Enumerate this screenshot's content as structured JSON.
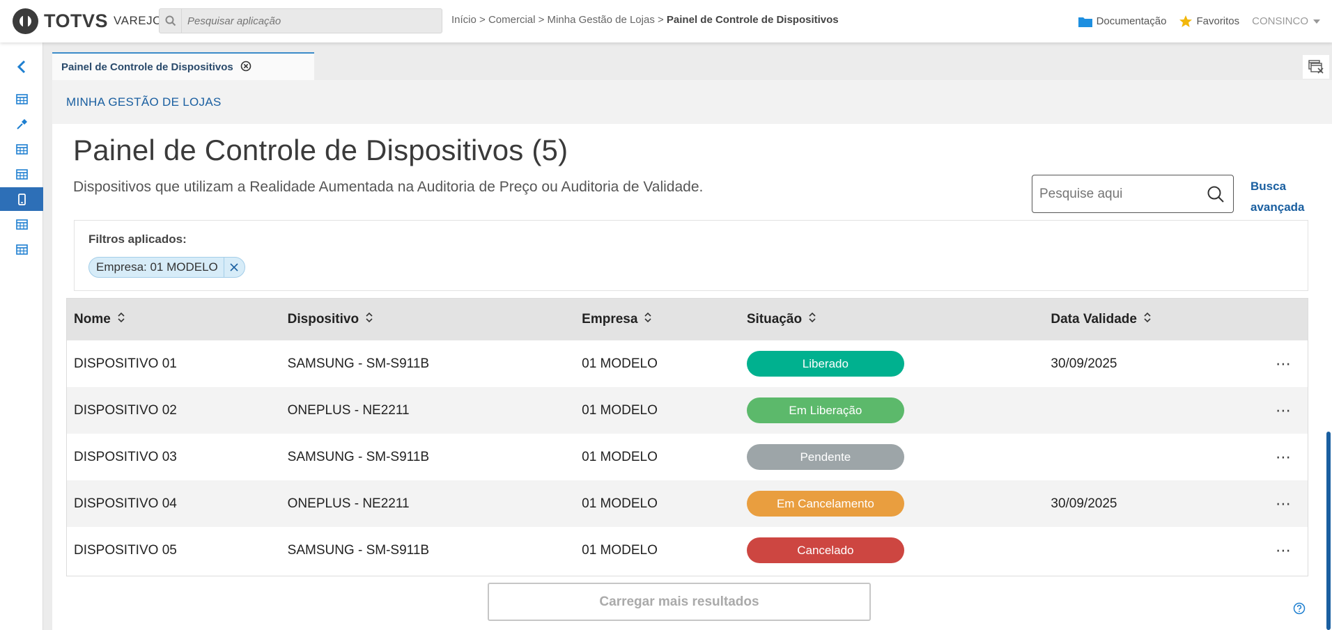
{
  "app": {
    "brand": "TOTVS",
    "product": "VAREJO",
    "search_placeholder": "Pesquisar aplicação"
  },
  "breadcrumb": {
    "path": "Início > Comercial > Minha Gestão de Lojas > ",
    "current": "Painel de Controle de Dispositivos"
  },
  "topbar": {
    "documentation": "Documentação",
    "favorites": "Favoritos",
    "user": "CONSINCO"
  },
  "tab": {
    "label": "Painel de Controle de Dispositivos"
  },
  "section": {
    "header": "MINHA GESTÃO DE LOJAS"
  },
  "page": {
    "title": "Painel de Controle de Dispositivos (5)",
    "subtitle": "Dispositivos que utilizam a Realidade Aumentada na Auditoria de Preço ou Auditoria de Validade.",
    "search_placeholder": "Pesquise aqui",
    "advanced_search_line1": "Busca",
    "advanced_search_line2": "avançada"
  },
  "filters": {
    "label": "Filtros aplicados:",
    "chips": [
      "Empresa: 01 MODELO"
    ]
  },
  "table": {
    "columns": [
      "Nome",
      "Dispositivo",
      "Empresa",
      "Situação",
      "Data Validade"
    ],
    "rows": [
      {
        "nome": "DISPOSITIVO 01",
        "dispositivo": "SAMSUNG - SM-S911B",
        "empresa": "01 MODELO",
        "situacao": "Liberado",
        "situacao_color": "#00b18f",
        "validade": "30/09/2025"
      },
      {
        "nome": "DISPOSITIVO 02",
        "dispositivo": "ONEPLUS - NE2211",
        "empresa": "01 MODELO",
        "situacao": "Em Liberação",
        "situacao_color": "#5cb96b",
        "validade": ""
      },
      {
        "nome": "DISPOSITIVO 03",
        "dispositivo": "SAMSUNG - SM-S911B",
        "empresa": "01 MODELO",
        "situacao": "Pendente",
        "situacao_color": "#9da5a8",
        "validade": ""
      },
      {
        "nome": "DISPOSITIVO 04",
        "dispositivo": "ONEPLUS - NE2211",
        "empresa": "01 MODELO",
        "situacao": "Em Cancelamento",
        "situacao_color": "#e99e3f",
        "validade": "30/09/2025"
      },
      {
        "nome": "DISPOSITIVO 05",
        "dispositivo": "SAMSUNG - SM-S911B",
        "empresa": "01 MODELO",
        "situacao": "Cancelado",
        "situacao_color": "#cd4641",
        "validade": ""
      }
    ]
  },
  "load_more": "Carregar mais resultados",
  "sidebar": {
    "items": [
      "chevron-left-icon",
      "table-icon",
      "pin-icon",
      "table-icon",
      "table-icon",
      "mobile-icon",
      "table-icon",
      "table-icon"
    ],
    "active_index": 5
  },
  "colors": {
    "accent": "#1a5fa0",
    "sidebar_active": "#2d6fb7"
  }
}
